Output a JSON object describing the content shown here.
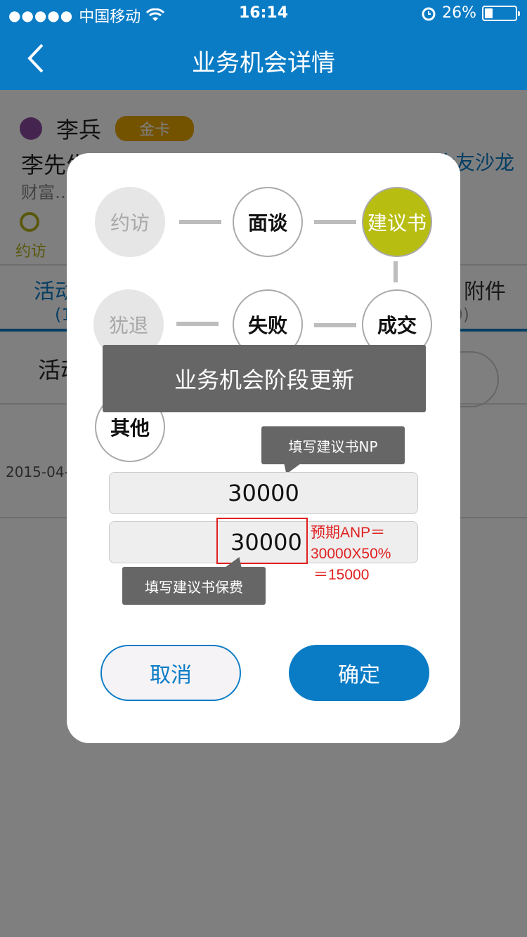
{
  "status_bar": {
    "carrier": "中国移动",
    "time": "16:14",
    "battery": "26%",
    "battery_level": 0.26
  },
  "nav": {
    "title": "业务机会详情"
  },
  "background": {
    "customer_name": "李兵",
    "vip_badge": "金卡",
    "text_line1": "李先生 …",
    "text_line2": "财富…",
    "club_link": "会友沙龙",
    "stage_label": "约访",
    "tab_left": "活动",
    "tab_left_count": "(1",
    "tab_right": "附件",
    "tab_right_count": "0)",
    "action_left": "活动",
    "date": "2015-04-…"
  },
  "modal": {
    "stages": [
      {
        "label": "约访",
        "state": "done"
      },
      {
        "label": "面谈",
        "state": "normal"
      },
      {
        "label": "建议书",
        "state": "current"
      },
      {
        "label": "犹退",
        "state": "done"
      },
      {
        "label": "失败",
        "state": "normal"
      },
      {
        "label": "成交",
        "state": "normal"
      },
      {
        "label": "其他",
        "state": "normal"
      }
    ],
    "toast": "业务机会阶段更新",
    "tip_np": "填写建议书NP",
    "np_value": "30000",
    "premium_value": "30000",
    "tip_premium": "填写建议书保费",
    "annotation_line1": "预期ANP＝30000X50%",
    "annotation_line2": "＝15000",
    "cancel_label": "取消",
    "ok_label": "确定"
  },
  "colors": {
    "primary": "#0a7cc6",
    "current_stage": "#b8bd12",
    "annotation_red": "#e02020",
    "tooltip": "#666666"
  }
}
